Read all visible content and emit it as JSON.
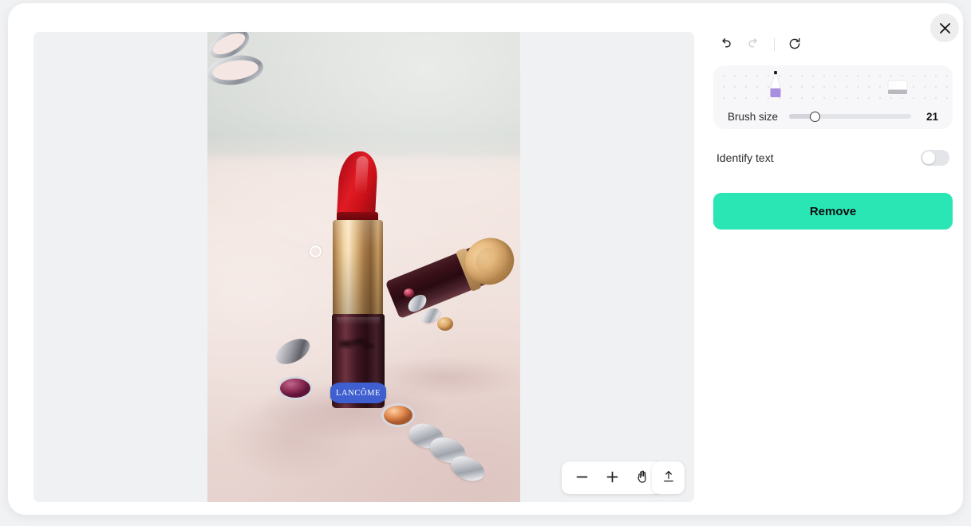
{
  "window": {
    "close_label": "Close",
    "close_icon": "close-icon"
  },
  "editor": {
    "history": {
      "undo_label": "Undo",
      "undo_icon": "undo-icon",
      "undo_enabled": "true",
      "redo_label": "Redo",
      "redo_icon": "redo-icon",
      "redo_enabled": "false",
      "reset_label": "Reset",
      "reset_icon": "reset-icon"
    },
    "tools": {
      "brush": {
        "label": "Brush",
        "icon": "brush-icon",
        "selected": "true",
        "color": "#a98fe0"
      },
      "eraser": {
        "label": "Eraser",
        "icon": "eraser-icon",
        "selected": "false"
      }
    },
    "brush_size": {
      "label": "Brush size",
      "value": "21",
      "min": "1",
      "max": "100",
      "percent": "21"
    },
    "identify_text": {
      "label": "Identify text",
      "state": "off"
    },
    "remove": {
      "label": "Remove",
      "accent_color": "#2ae6b5"
    },
    "viewport": {
      "zoom_out": {
        "label": "Zoom out",
        "icon": "minus-icon"
      },
      "zoom_in": {
        "label": "Zoom in",
        "icon": "plus-icon"
      },
      "pan": {
        "label": "Pan",
        "icon": "hand-icon"
      },
      "export": {
        "label": "Export",
        "icon": "upload-icon"
      },
      "cursor": {
        "name": "brush-cursor"
      }
    },
    "image": {
      "alt": "Red Lancome lipstick standing upright with a second lipstick lying behind it and a silver gemstone chain bracelet on a pink surface",
      "brand_label": "LANCÔME"
    }
  }
}
